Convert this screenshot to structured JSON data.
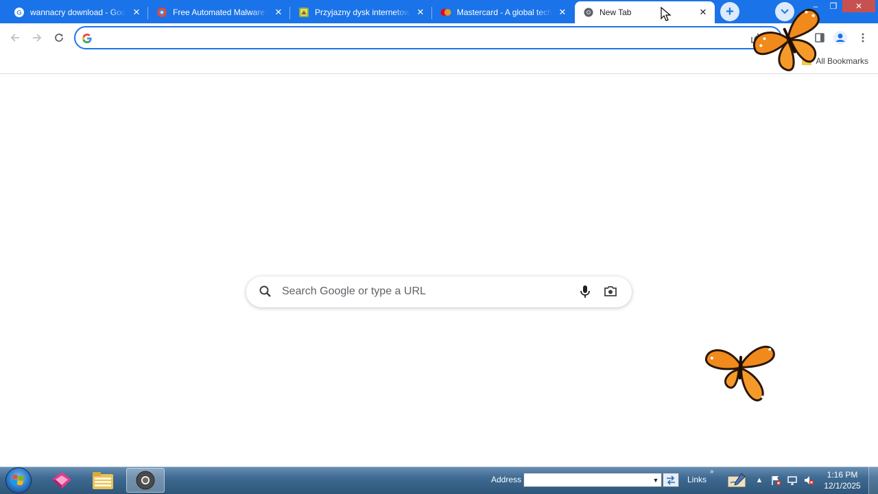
{
  "browser": {
    "tabs": [
      {
        "title": "wannacry download - Goo",
        "favicon": "google-g-icon",
        "active": false
      },
      {
        "title": "Free Automated Malware Analysis",
        "favicon": "analysis-site-icon",
        "active": false
      },
      {
        "title": "Przyjazny dysk internetowy",
        "favicon": "cloud-drive-icon",
        "active": false
      },
      {
        "title": "Mastercard - A global tech",
        "favicon": "mastercard-icon",
        "active": false
      },
      {
        "title": "New Tab",
        "favicon": "chrome-icon",
        "active": true
      }
    ],
    "new_tab_symbol": "+",
    "close_symbol": "✕",
    "window_controls": {
      "minimize": "–",
      "maximize": "❐",
      "close": "✕"
    },
    "omnibox": {
      "value": "",
      "placeholder": ""
    },
    "bookmarks_bar": {
      "all_bookmarks_label": "All Bookmarks"
    },
    "ntp": {
      "search_placeholder": "Search Google or type a URL"
    },
    "accent_color": "#1a73e8"
  },
  "taskbar": {
    "address_label": "Address",
    "address_value": "",
    "links_label": "Links",
    "links_chevron": "»",
    "tray_arrow": "▲",
    "clock_time": "1:16 PM",
    "clock_date": "12/1/2025",
    "pinned": [
      "colorful-app-icon",
      "file-explorer-icon",
      "chrome-icon"
    ]
  }
}
